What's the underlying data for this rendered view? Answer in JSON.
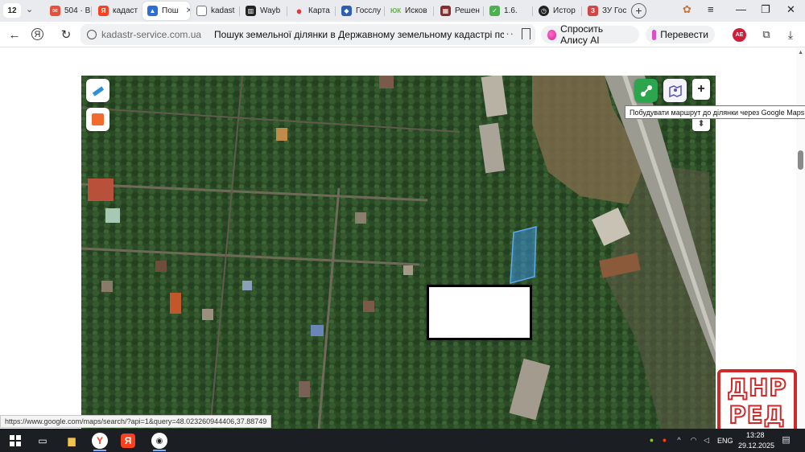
{
  "tabbar": {
    "tab_count": "12",
    "tabs": [
      {
        "label": "504 · В",
        "icon": "mail-icon",
        "color": "#e8503a"
      },
      {
        "label": "кадаст",
        "icon": "yandex-icon",
        "color": "#fc3f1d"
      },
      {
        "label": "Пош",
        "icon": "kadastr-icon",
        "color": "#2b6fd6"
      },
      {
        "label": "kadast",
        "icon": "document-icon",
        "color": "#555555"
      },
      {
        "label": "Wayb",
        "icon": "wayback-icon",
        "color": "#222222"
      },
      {
        "label": "Карта",
        "icon": "map-pin-icon",
        "color": "#e53935"
      },
      {
        "label": "Госслу",
        "icon": "gov-icon",
        "color": "#2f5fb3"
      },
      {
        "label": "Исков",
        "icon": "lawsuit-icon",
        "color": "#6aa84f"
      },
      {
        "label": "Решен",
        "icon": "court-icon",
        "color": "#8b2b2b"
      },
      {
        "label": "1.6.",
        "icon": "sheet-icon",
        "color": "#4caf50"
      },
      {
        "label": "Истор",
        "icon": "history-icon",
        "color": "#222222"
      },
      {
        "label": "ЗУ Гос",
        "icon": "zu-icon",
        "color": "#d64545"
      }
    ]
  },
  "omnibox": {
    "domain": "kadastr-service.com.ua",
    "title": "Пошук земельної ділянки в Державному земельному кадастрі по..."
  },
  "toolbar": {
    "alice_label": "Спросить Алису AI",
    "translate_label": "Перевести",
    "profile_initials": "AE"
  },
  "map": {
    "tooltip": "Побудувати маршрут до ділянки через Google Maps",
    "zoom_in_label": "+",
    "highlight_color": "#3a8fd6",
    "route_button_color": "#2da44e"
  },
  "status_bar": {
    "url": "https://www.google.com/maps/search/?api=1&query=48.023260944406,37.88749"
  },
  "watermark": {
    "line1": "ДНР",
    "line2": "РЕД",
    "color": "#cf2a2a"
  },
  "taskbar": {
    "language": "ENG",
    "time": "13:28",
    "date": "29.12.2025"
  }
}
